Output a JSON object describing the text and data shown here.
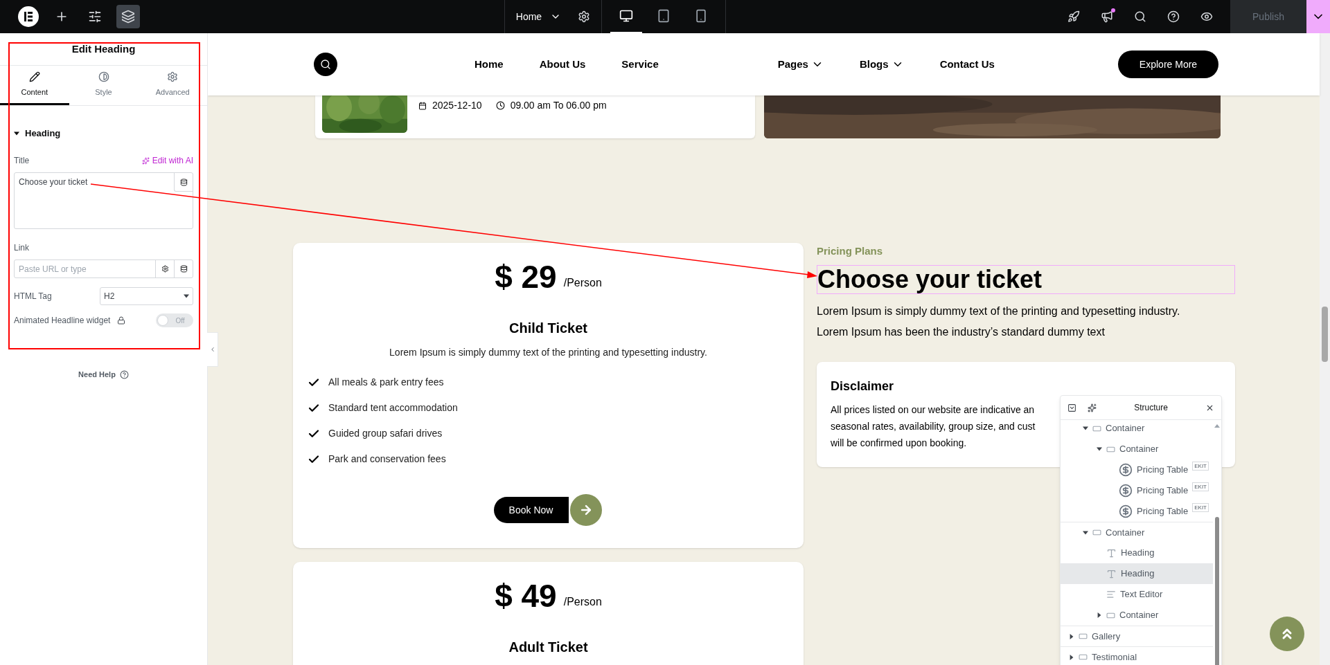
{
  "topbar": {
    "tools": [
      {
        "kind": "logo",
        "selected": false
      },
      {
        "kind": "add",
        "selected": false
      },
      {
        "kind": "settings",
        "selected": false
      },
      {
        "kind": "layers",
        "selected": true
      }
    ],
    "page_menu": {
      "label": "Home"
    },
    "devices": [
      {
        "kind": "desktop",
        "selected": true
      },
      {
        "kind": "tablet",
        "selected": false
      },
      {
        "kind": "mobile",
        "selected": false
      }
    ],
    "actions": [
      {
        "kind": "rocket",
        "badge": false
      },
      {
        "kind": "notes",
        "badge": true
      },
      {
        "kind": "search",
        "badge": false
      },
      {
        "kind": "help",
        "badge": false
      },
      {
        "kind": "preview",
        "badge": false
      }
    ],
    "publish": {
      "label": "Publish",
      "disabled": true
    }
  },
  "panel": {
    "title": "Edit Heading",
    "tabs": [
      {
        "label": "Content",
        "kind": "content",
        "selected": true
      },
      {
        "label": "Style",
        "kind": "style",
        "selected": false
      },
      {
        "label": "Advanced",
        "kind": "advanced",
        "selected": false
      }
    ],
    "section": {
      "label": "Heading",
      "expanded": true
    },
    "title_field": {
      "label": "Title",
      "ai_link": "Edit with AI",
      "value": "Choose your ticket"
    },
    "link_field": {
      "label": "Link",
      "placeholder": "Paste URL or type"
    },
    "tag_field": {
      "label": "HTML Tag",
      "value": "H2"
    },
    "animated": {
      "label": "Animated Headline widget",
      "locked": true,
      "on": false,
      "state_text": "Off"
    },
    "help": "Need Help"
  },
  "site": {
    "nav": [
      {
        "label": "Home",
        "dropdown": false
      },
      {
        "label": "About Us",
        "dropdown": false
      },
      {
        "label": "Service",
        "dropdown": false
      },
      {
        "label": "Pages",
        "dropdown": true
      },
      {
        "label": "Blogs",
        "dropdown": true
      },
      {
        "label": "Contact Us",
        "dropdown": false
      }
    ],
    "cta": "Explore More",
    "event": {
      "date": "2025-12-10",
      "time": "09.00 am To 06.00 pm"
    },
    "cards": [
      {
        "price": "$ 29",
        "unit": "/Person",
        "title": "Child Ticket",
        "text": "Lorem Ipsum is simply dummy text of the printing and typesetting industry.",
        "features": [
          "All meals & park entry fees",
          "Standard tent accommodation",
          "Guided group safari drives",
          "Park and conservation fees"
        ],
        "button": "Book Now"
      },
      {
        "price": "$ 49",
        "unit": "/Person",
        "title": "Adult Ticket"
      }
    ],
    "eyebrow": "Pricing Plans",
    "heading": {
      "text": "Choose your ticket",
      "selected": true
    },
    "paragraph": [
      "Lorem Ipsum is simply dummy text of the printing and typesetting industry.",
      "Lorem Ipsum has been the industry’s standard dummy text"
    ],
    "disclaimer": {
      "title": "Disclaimer",
      "lines": [
        "All prices listed on our website are indicative an",
        "seasonal rates, availability, group size, and cust",
        "will be confirmed upon booking."
      ]
    }
  },
  "structure": {
    "title": "Structure",
    "items": [
      {
        "kind": "hidden",
        "children": [
          {
            "label": "Container",
            "kind": "container",
            "expanded": true,
            "selected": false,
            "children": [
              {
                "label": "Container",
                "kind": "container",
                "expanded": true,
                "selected": false,
                "children": [
                  {
                    "label": "Pricing Table",
                    "kind": "pricing",
                    "selected": false,
                    "badge": "EKIT"
                  },
                  {
                    "label": "Pricing Table",
                    "kind": "pricing",
                    "selected": false,
                    "badge": "EKIT"
                  },
                  {
                    "label": "Pricing Table",
                    "kind": "pricing",
                    "selected": false,
                    "badge": "EKIT"
                  }
                ]
              }
            ]
          },
          {
            "label": "Container",
            "kind": "container",
            "expanded": true,
            "selected": false,
            "children": [
              {
                "label": "Heading",
                "kind": "heading",
                "selected": false
              },
              {
                "label": "Heading",
                "kind": "heading",
                "selected": true
              },
              {
                "label": "Text Editor",
                "kind": "text",
                "selected": false
              },
              {
                "label": "Container",
                "kind": "container",
                "expanded": false,
                "selected": false
              }
            ]
          }
        ]
      },
      {
        "label": "Gallery",
        "kind": "container",
        "expanded": false,
        "selected": false
      },
      {
        "label": "Testimonial",
        "kind": "container",
        "expanded": false,
        "selected": false
      }
    ]
  }
}
